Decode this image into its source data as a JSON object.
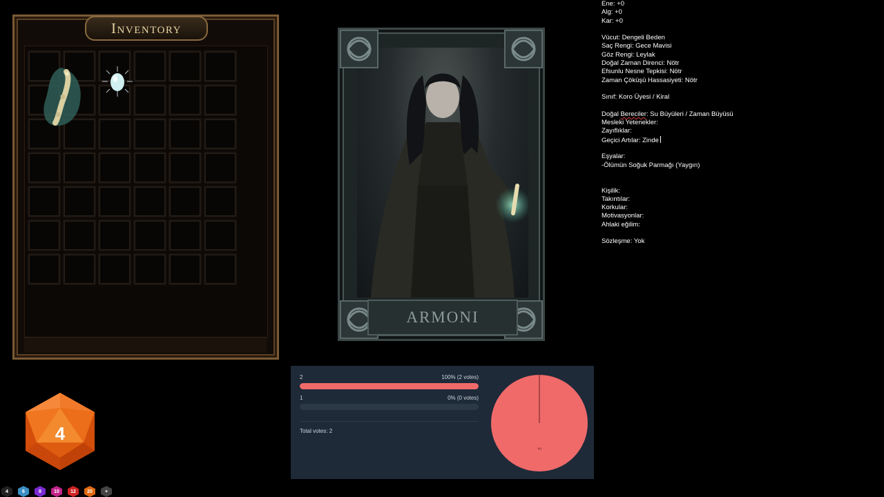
{
  "inventory": {
    "title": "Inventory",
    "rows": 7,
    "cols": 6,
    "items": [
      {
        "name": "Ölümün Soğuk Parmağı",
        "icon": "bone-finger-icon",
        "slot": "row 1-2, col 1-2"
      },
      {
        "name": "gem",
        "icon": "glowing-gem-icon",
        "slot": "row 1, col 3"
      }
    ]
  },
  "character": {
    "card_name": "ARMONI"
  },
  "sheet": {
    "lines": [
      "Ene: +0",
      "Alg: +0",
      "Kar: +0",
      "",
      "Vücut: Dengeli Beden",
      "Saç Rengi: Gece Mavisi",
      "Göz Rengi: Leylak",
      "Doğal Zaman Direnci: Nötr",
      "Efsunlu Nesne Tepkisi: Nötr",
      "Zaman Çöküşü Hassasiyeti: Nötr",
      "",
      "Sınıf: Koro Üyesi / Kiral",
      "",
      "Doğal Bereciler: Su Büyüleri / Zaman Büyüsü",
      "Mesleki Yetenekler:",
      "Zayıflıklar:",
      "Geçici Artılar: Zinde",
      "",
      "Eşyalar:",
      "-Ölümün Soğuk Parmağı (Yaygın)",
      "",
      "",
      "Kişilik:",
      "Takıntılar:",
      "Korkular:",
      "Motivasyonlar:",
      "Ahlaki eğilim:",
      "",
      "Sözleşme: Yok"
    ]
  },
  "poll": {
    "options": [
      {
        "label": "2",
        "stat": "100% (2 votes)",
        "percent": 100,
        "color": "#f06a6a"
      },
      {
        "label": "1",
        "stat": "0% (0 votes)",
        "percent": 0,
        "color": "#f06a6a"
      }
    ],
    "total": "Total votes: 2",
    "pie_label": "2"
  },
  "dice": {
    "main_value": "4",
    "bar": [
      {
        "label": "4",
        "icon": "d4-icon",
        "color": "#222222"
      },
      {
        "label": "6",
        "icon": "d6-icon",
        "color": "#3b8fc4"
      },
      {
        "label": "8",
        "icon": "d8-icon",
        "color": "#7a2bd1"
      },
      {
        "label": "10",
        "icon": "d10-icon",
        "color": "#c2248a"
      },
      {
        "label": "12",
        "icon": "d12-icon",
        "color": "#d02424"
      },
      {
        "label": "20",
        "icon": "d20-icon",
        "color": "#e06a12"
      },
      {
        "label": "+",
        "icon": "add-die-icon",
        "color": "#444444"
      }
    ]
  }
}
